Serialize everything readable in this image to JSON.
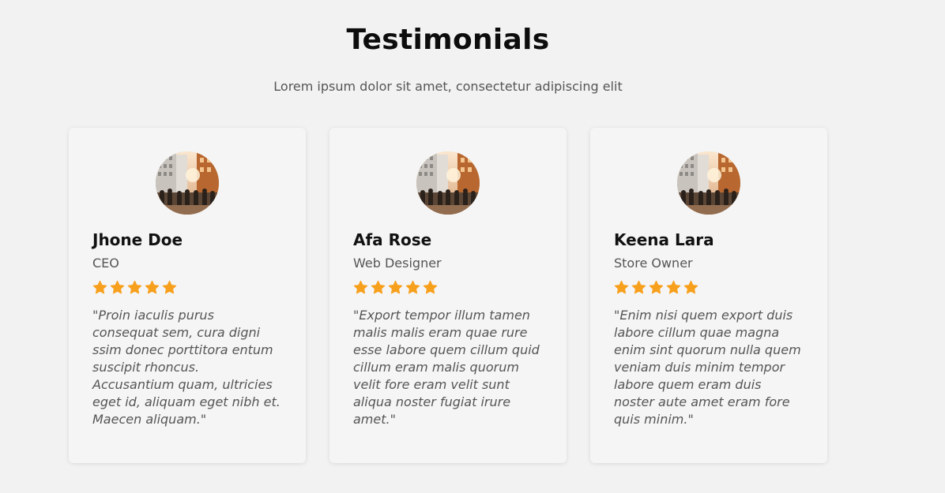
{
  "header": {
    "title": "Testimonials",
    "subtitle": "Lorem ipsum dolor sit amet, consectetur adipiscing elit"
  },
  "colors": {
    "star": "#f7a01d",
    "background": "#f2f2f2",
    "card": "#f5f5f5"
  },
  "testimonials": [
    {
      "name": "Jhone Doe",
      "role": "CEO",
      "rating": 5,
      "quote": "\"Proin iaculis purus consequat sem, cura digni ssim donec porttitora entum suscipit rhoncus. Accusantium quam, ultricies eget id, aliquam eget nibh et. Maecen aliquam.\"",
      "avatar_icon": "city-street-photo"
    },
    {
      "name": "Afa Rose",
      "role": "Web Designer",
      "rating": 5,
      "quote": "\"Export tempor illum tamen malis malis eram quae rure esse labore quem cillum quid cillum eram malis quorum velit fore eram velit sunt aliqua noster fugiat irure amet.\"",
      "avatar_icon": "city-street-photo"
    },
    {
      "name": "Keena Lara",
      "role": "Store Owner",
      "rating": 5,
      "quote": "\"Enim nisi quem export duis labore cillum quae magna enim sint quorum nulla quem veniam duis minim tempor labore quem eram duis noster aute amet eram fore quis minim.\"",
      "avatar_icon": "city-street-photo"
    }
  ]
}
